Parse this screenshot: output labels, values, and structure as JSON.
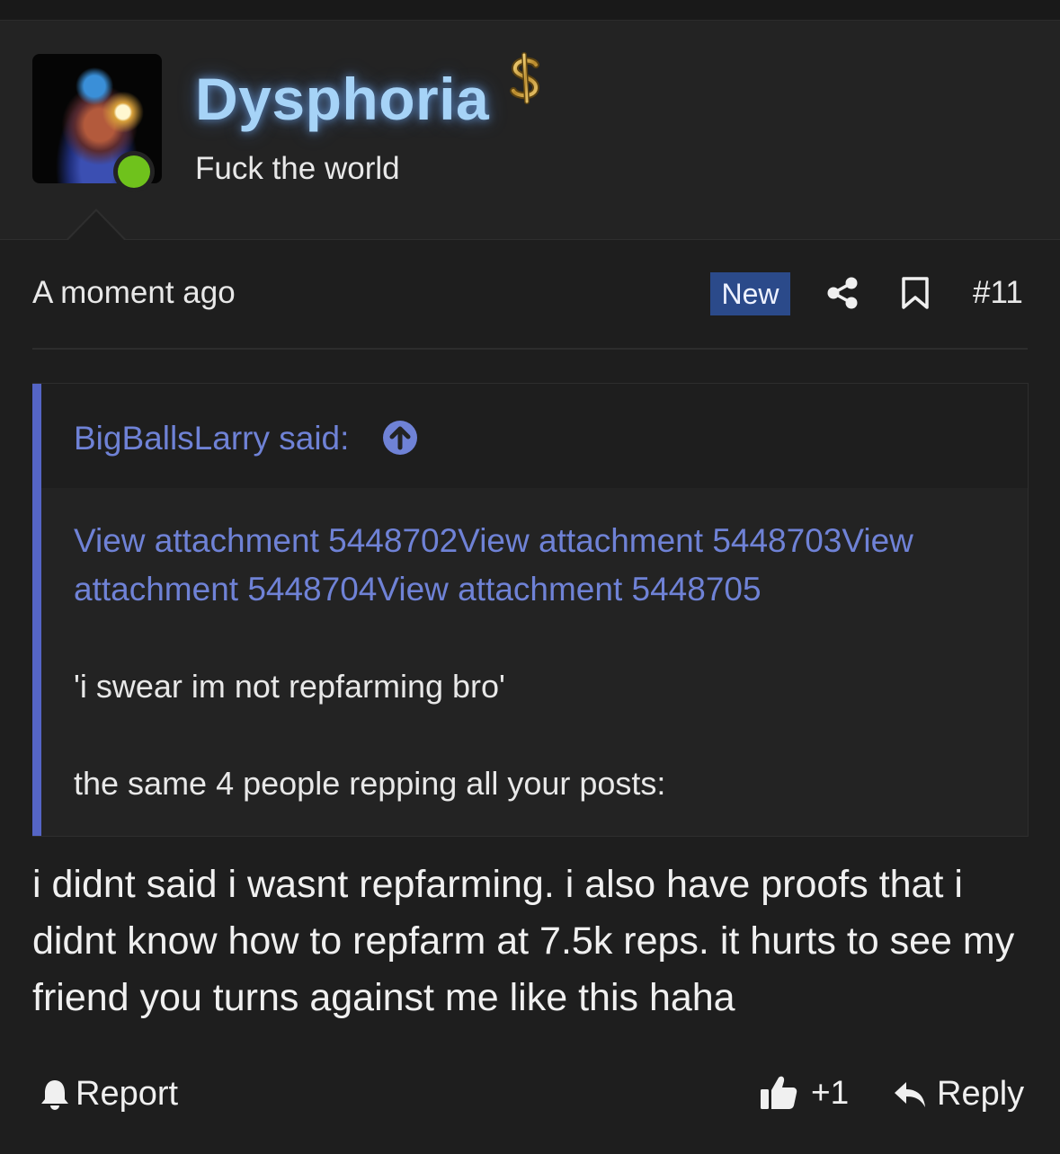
{
  "post": {
    "username": "Dysphoria",
    "user_title": "Fuck the world",
    "time": "A moment ago",
    "badge": "New",
    "number": "#11",
    "body": "i didnt said i wasnt repfarming. i also have proofs that i didnt know how to repfarm at 7.5k reps. it hurts to see my friend you turns against me like this haha"
  },
  "quote": {
    "author_said": "BigBallsLarry said:",
    "attachments": "View attachment 5448702View attachment 5448703View attachment 5448704View attachment 5448705",
    "line1": "'i swear im not repfarming bro'",
    "line2": "the same 4 people repping all your posts:"
  },
  "actions": {
    "report": "Report",
    "like_count": "+1",
    "reply": "Reply"
  },
  "icons": {
    "rank": "dollar-icon",
    "online": "online-status-icon",
    "share": "share-icon",
    "bookmark": "bookmark-icon",
    "jump": "arrow-up-circle-icon",
    "report": "bell-icon",
    "like": "thumbs-up-icon",
    "reply": "reply-arrow-icon"
  },
  "colors": {
    "accent": "#6f82d6",
    "quote_bar": "#5565c5",
    "badge_bg": "#2b4a8a",
    "online": "#6fc21c",
    "username_glow": "#a6d3f7"
  }
}
